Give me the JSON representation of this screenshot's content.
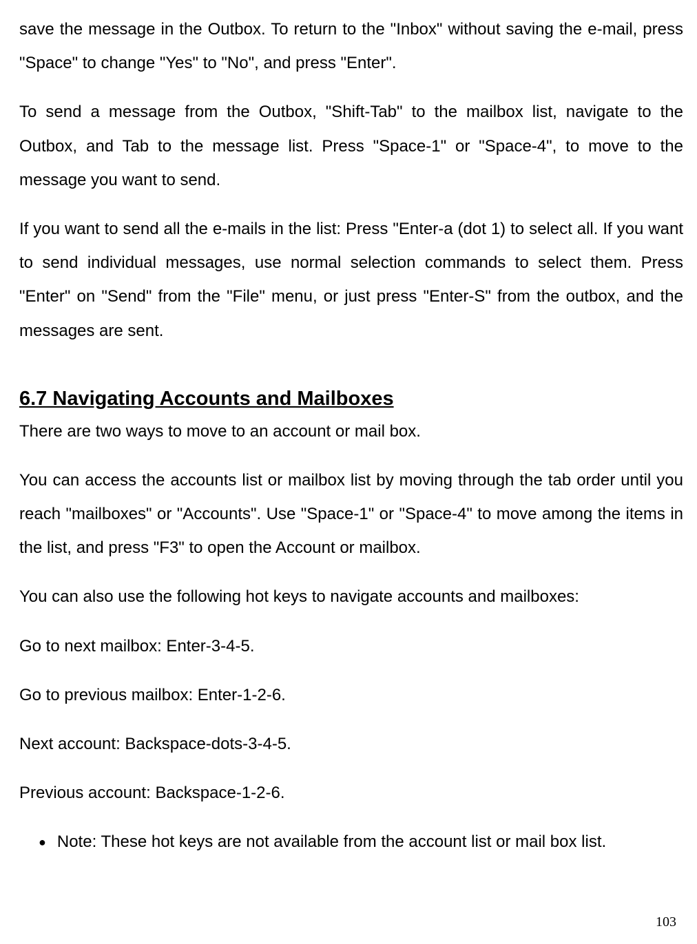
{
  "paragraphs": {
    "p1": "save the message in the Outbox. To return to the \"Inbox\" without saving the e-mail, press \"Space\" to change \"Yes\" to \"No\", and press \"Enter\".",
    "p2": "To send a message from the Outbox, \"Shift-Tab\" to the mailbox list, navigate to the Outbox, and Tab to the message list.  Press \"Space-1\" or \"Space-4\", to move to the message you want to send.",
    "p3": "If you want to send all the e-mails in the list: Press \"Enter-a (dot 1) to select all. If you want to send individual messages, use normal selection commands to select them. Press \"Enter\" on \"Send\" from the \"File\" menu, or just press \"Enter-S\" from the outbox, and the messages are sent.",
    "heading": "6.7 Navigating Accounts and Mailboxes",
    "p4": "There are two ways to move to an account or mail box.",
    "p5": "You can access the accounts list or mailbox list by moving through the tab order until you reach \"mailboxes\" or \"Accounts\". Use \"Space-1\" or \"Space-4\" to move among the items in the list, and press \"F3\" to open the Account or mailbox.",
    "p6": "You can also use the following hot keys to navigate accounts and mailboxes:",
    "p7": "Go to next mailbox: Enter-3-4-5.",
    "p8": "Go to previous mailbox: Enter-1-2-6.",
    "p9": "Next account: Backspace-dots-3-4-5.",
    "p10": "Previous account: Backspace-1-2-6.",
    "note": "Note: These hot keys are not available from the account list or mail box list."
  },
  "page_number": "103"
}
